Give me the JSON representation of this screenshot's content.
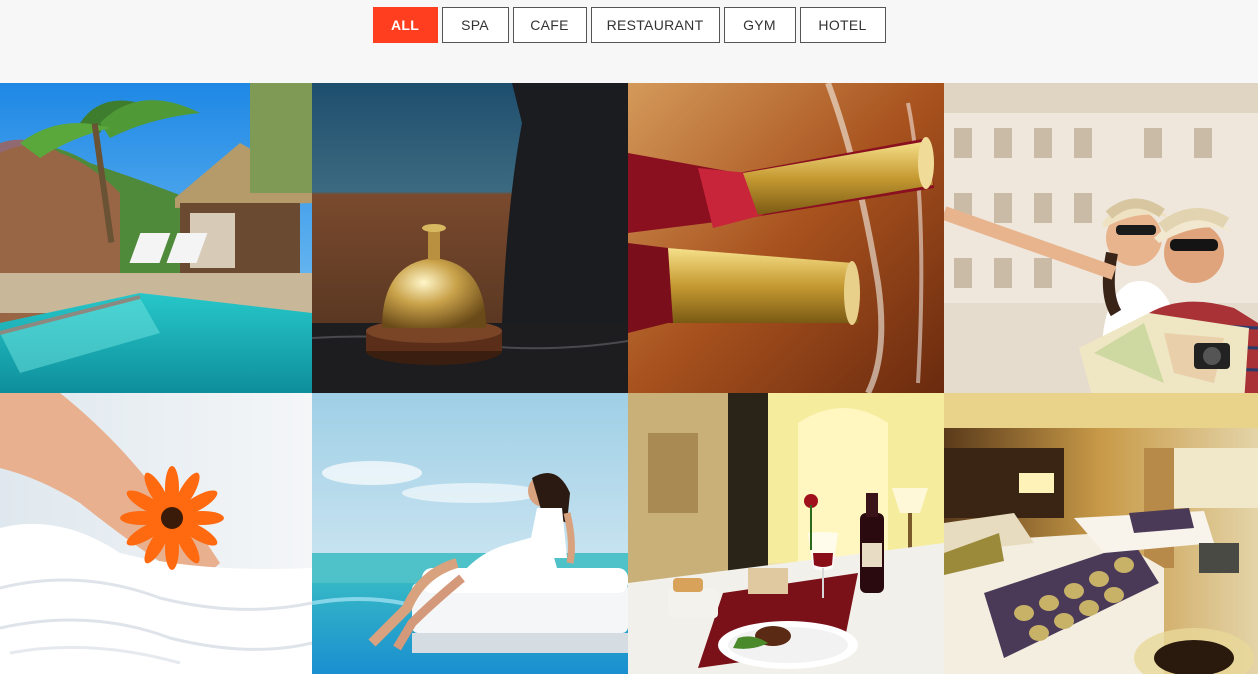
{
  "filters": [
    {
      "label": "ALL",
      "active": true
    },
    {
      "label": "SPA",
      "active": false
    },
    {
      "label": "CAFE",
      "active": false
    },
    {
      "label": "RESTAURANT",
      "active": false
    },
    {
      "label": "GYM",
      "active": false
    },
    {
      "label": "HOTEL",
      "active": false
    }
  ],
  "colors": {
    "accent": "#ff3d1f",
    "page_background": "#f7f7f7",
    "button_border": "#555555"
  },
  "gallery": {
    "tiles": [
      {
        "subject": "tropical-pool-villa"
      },
      {
        "subject": "reception-bell"
      },
      {
        "subject": "champagne-bottles"
      },
      {
        "subject": "tourists-with-map"
      },
      {
        "subject": "spa-towels-flower"
      },
      {
        "subject": "woman-poolside-lounger"
      },
      {
        "subject": "restaurant-table-dinner"
      },
      {
        "subject": "hotel-bedroom"
      }
    ]
  }
}
